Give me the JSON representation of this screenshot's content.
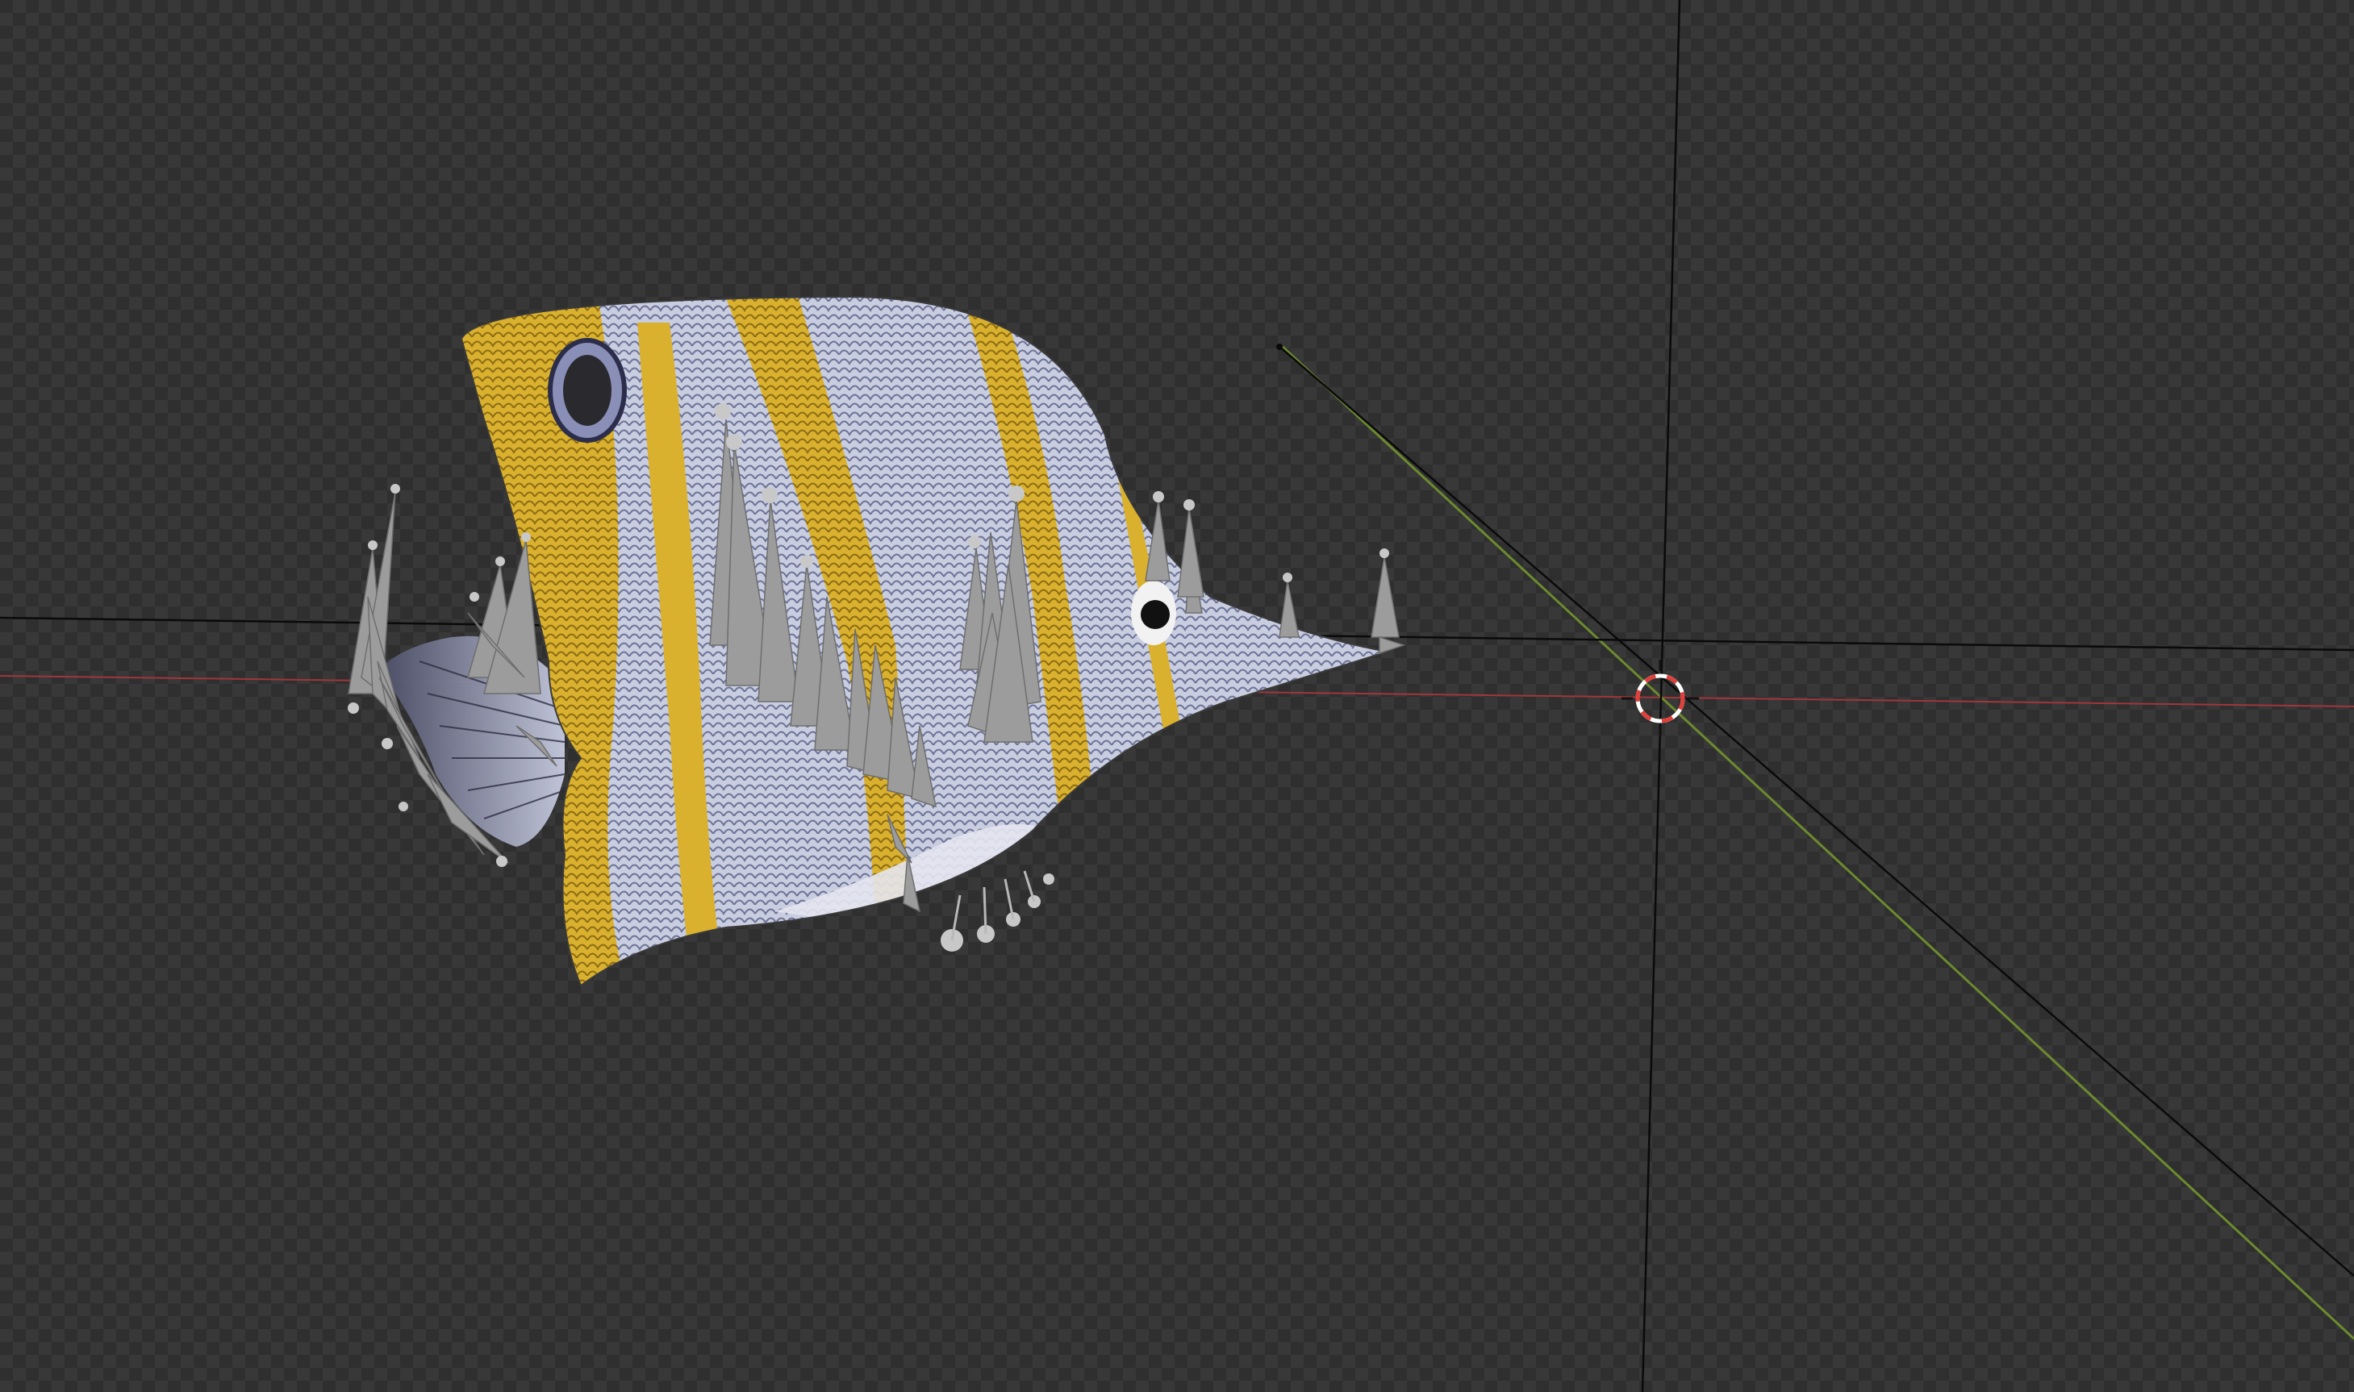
{
  "viewport": {
    "kind": "3d-viewport",
    "background_pattern": "checkerboard",
    "colors": {
      "checker_dark": "#2f2f2f",
      "checker_light": "#383838",
      "axis_x": "#a0363c",
      "axis_y": "#6c8a2e",
      "axis_neutral": "#0a0a0a",
      "cursor_red": "#e0403c",
      "cursor_white": "#ffffff",
      "fish_white": "#c9cde0",
      "fish_yellow": "#d9b12e",
      "bone_gray": "#9c9c9c"
    }
  },
  "objects": {
    "mesh": "fish-mesh",
    "armature": "fish-armature",
    "cursor": "3d-cursor-icon"
  }
}
